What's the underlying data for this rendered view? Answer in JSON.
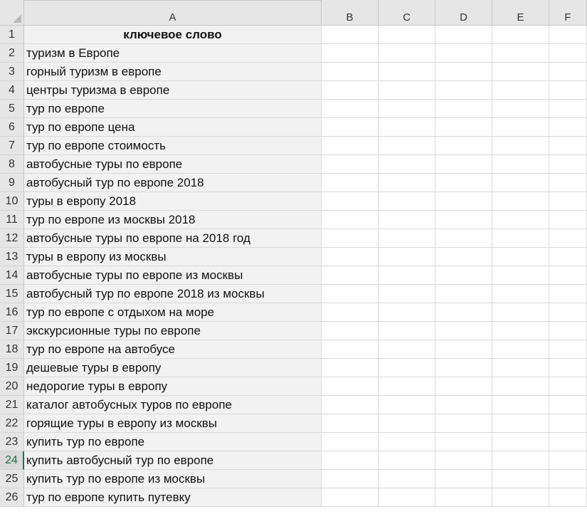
{
  "columns": [
    "A",
    "B",
    "C",
    "D",
    "E",
    "F"
  ],
  "rows": [
    {
      "num": "1",
      "value": "ключевое слово"
    },
    {
      "num": "2",
      "value": "туризм в Европе"
    },
    {
      "num": "3",
      "value": "горный туризм в европе"
    },
    {
      "num": "4",
      "value": "центры туризма в европе"
    },
    {
      "num": "5",
      "value": "тур по европе"
    },
    {
      "num": "6",
      "value": "тур по европе цена"
    },
    {
      "num": "7",
      "value": "тур по европе стоимость"
    },
    {
      "num": "8",
      "value": "автобусные туры по европе"
    },
    {
      "num": "9",
      "value": "автобусный тур по европе 2018"
    },
    {
      "num": "10",
      "value": "туры в европу 2018"
    },
    {
      "num": "11",
      "value": "тур по европе из москвы 2018"
    },
    {
      "num": "12",
      "value": "автобусные туры по европе на 2018 год"
    },
    {
      "num": "13",
      "value": "туры в европу из москвы"
    },
    {
      "num": "14",
      "value": "автобусные туры по европе из москвы"
    },
    {
      "num": "15",
      "value": "автобусный тур по европе 2018 из москвы"
    },
    {
      "num": "16",
      "value": "тур по европе с отдыхом на море"
    },
    {
      "num": "17",
      "value": "экскурсионные туры по европе"
    },
    {
      "num": "18",
      "value": "тур по европе на автобусе"
    },
    {
      "num": "19",
      "value": "дешевые туры в европу"
    },
    {
      "num": "20",
      "value": "недорогие туры в европу"
    },
    {
      "num": "21",
      "value": "каталог автобусных туров по европе"
    },
    {
      "num": "22",
      "value": "горящие туры в европу из москвы"
    },
    {
      "num": "23",
      "value": "купить тур по европе"
    },
    {
      "num": "24",
      "value": "купить автобусный тур по европе"
    },
    {
      "num": "25",
      "value": "купить тур по европе из москвы"
    },
    {
      "num": "26",
      "value": "тур по европе купить путевку"
    }
  ],
  "active_row": "24",
  "colors": {
    "header_bg": "#e6e6e6",
    "column_a_fill": "#f2f2f2",
    "active_accent": "#217346"
  }
}
